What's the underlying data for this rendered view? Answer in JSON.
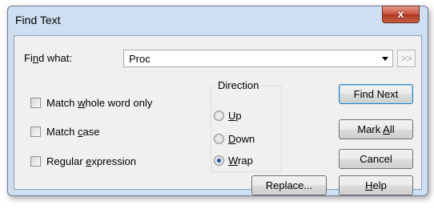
{
  "window": {
    "title": "Find Text",
    "close_glyph": "x"
  },
  "find": {
    "label_pre": "Fi",
    "label_key": "n",
    "label_post": "d what:",
    "value": "Proc",
    "more_label": ">>"
  },
  "options": {
    "whole_word": {
      "pre": "Match ",
      "key": "w",
      "post": "hole word only",
      "checked": false
    },
    "match_case": {
      "pre": "Match ",
      "key": "c",
      "post": "ase",
      "checked": false
    },
    "regex": {
      "pre": "Regular ",
      "key": "e",
      "post": "xpression",
      "checked": false
    }
  },
  "direction": {
    "title": "Direction",
    "up": {
      "key": "U",
      "post": "p",
      "selected": false
    },
    "down": {
      "key": "D",
      "post": "own",
      "selected": false
    },
    "wrap": {
      "key": "W",
      "post": "rap",
      "selected": true
    }
  },
  "buttons": {
    "find_next": "Find Next",
    "mark_all": {
      "pre": "Mark ",
      "key": "A",
      "post": "ll"
    },
    "cancel": "Cancel",
    "replace": "Replace...",
    "help": {
      "key": "H",
      "post": "elp"
    }
  }
}
